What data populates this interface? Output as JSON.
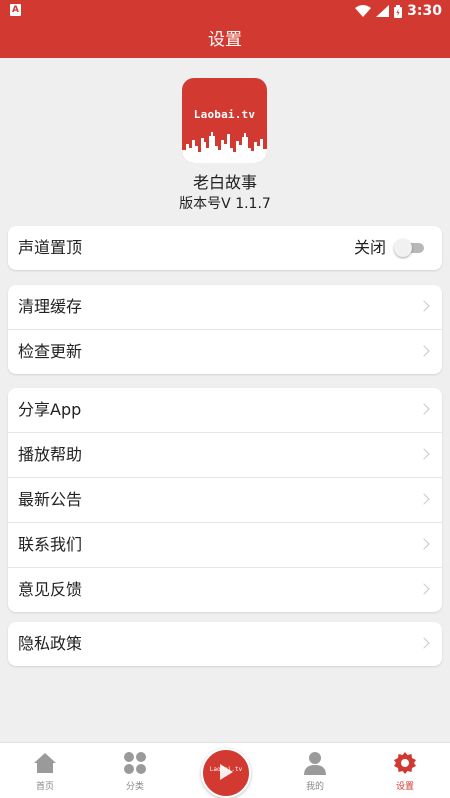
{
  "status_bar": {
    "time": "3:30",
    "notification_icon": "a-icon",
    "wifi_icon": "wifi-icon",
    "signal_icon": "signal-icon",
    "battery_icon": "battery-icon"
  },
  "header": {
    "title": "设置"
  },
  "app": {
    "logo_text": "Laobai.tv",
    "name": "老白故事",
    "version": "版本号V 1.1.7",
    "brand_color": "#d23a31"
  },
  "sections": {
    "audio": {
      "label": "声道置顶",
      "toggle_label": "关闭",
      "toggle_on": false
    },
    "cache": [
      {
        "label": "清理缓存"
      },
      {
        "label": "检查更新"
      }
    ],
    "more": [
      {
        "label": "分享App"
      },
      {
        "label": "播放帮助"
      },
      {
        "label": "最新公告"
      },
      {
        "label": "联系我们"
      },
      {
        "label": "意见反馈"
      }
    ],
    "privacy": [
      {
        "label": "隐私政策"
      }
    ]
  },
  "tabbar": {
    "home": "首页",
    "category": "分类",
    "center_logo": "Laobai.tv",
    "mine": "我的",
    "settings": "设置",
    "active": "settings"
  }
}
